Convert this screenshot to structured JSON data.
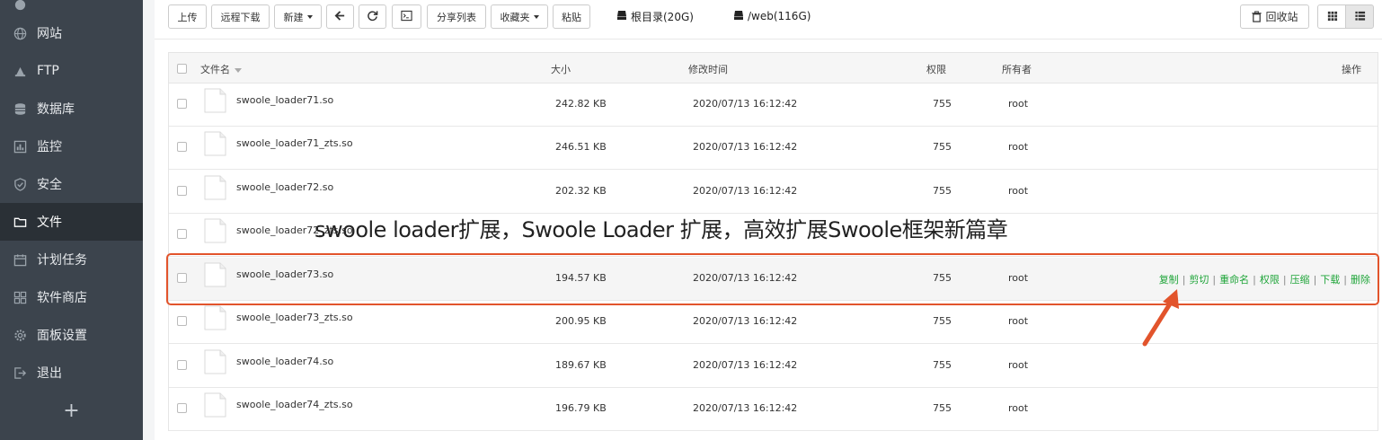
{
  "sidebar": {
    "items": [
      {
        "label": "网站",
        "icon": "globe-icon"
      },
      {
        "label": "FTP",
        "icon": "ftp-icon"
      },
      {
        "label": "数据库",
        "icon": "database-icon"
      },
      {
        "label": "监控",
        "icon": "monitor-icon"
      },
      {
        "label": "安全",
        "icon": "shield-icon"
      },
      {
        "label": "文件",
        "icon": "folder-icon",
        "active": true
      },
      {
        "label": "计划任务",
        "icon": "calendar-icon"
      },
      {
        "label": "软件商店",
        "icon": "apps-icon"
      },
      {
        "label": "面板设置",
        "icon": "gear-icon"
      },
      {
        "label": "退出",
        "icon": "logout-icon"
      }
    ],
    "add_label": "+"
  },
  "toolbar": {
    "upload": "上传",
    "remote_download": "远程下载",
    "new": "新建",
    "share_list": "分享列表",
    "favorites": "收藏夹",
    "paste": "粘贴",
    "disks": [
      {
        "label": "根目录(20G)"
      },
      {
        "label": "/web(116G)"
      }
    ],
    "recycle_bin": "回收站"
  },
  "table": {
    "headers": {
      "name": "文件名",
      "size": "大小",
      "modified": "修改时间",
      "permission": "权限",
      "owner": "所有者",
      "actions": "操作"
    },
    "rows": [
      {
        "name": "swoole_loader71.so",
        "size": "242.82 KB",
        "modified": "2020/07/13 16:12:42",
        "permission": "755",
        "owner": "root"
      },
      {
        "name": "swoole_loader71_zts.so",
        "size": "246.51 KB",
        "modified": "2020/07/13 16:12:42",
        "permission": "755",
        "owner": "root"
      },
      {
        "name": "swoole_loader72.so",
        "size": "202.32 KB",
        "modified": "2020/07/13 16:12:42",
        "permission": "755",
        "owner": "root"
      },
      {
        "name": "swoole_loader72_zts.so",
        "size": "",
        "modified": "",
        "permission": "",
        "owner": ""
      },
      {
        "name": "swoole_loader73.so",
        "size": "194.57 KB",
        "modified": "2020/07/13 16:12:42",
        "permission": "755",
        "owner": "root",
        "highlighted": true
      },
      {
        "name": "swoole_loader73_zts.so",
        "size": "200.95 KB",
        "modified": "2020/07/13 16:12:42",
        "permission": "755",
        "owner": "root"
      },
      {
        "name": "swoole_loader74.so",
        "size": "189.67 KB",
        "modified": "2020/07/13 16:12:42",
        "permission": "755",
        "owner": "root"
      },
      {
        "name": "swoole_loader74_zts.so",
        "size": "196.79 KB",
        "modified": "2020/07/13 16:12:42",
        "permission": "755",
        "owner": "root"
      }
    ],
    "row_actions": [
      "复制",
      "剪切",
      "重命名",
      "权限",
      "压缩",
      "下载",
      "删除"
    ]
  },
  "overlay": {
    "caption": "swoole loader扩展，Swoole Loader 扩展，高效扩展Swoole框架新篇章"
  },
  "colors": {
    "sidebar_bg": "#3c444d",
    "sidebar_active": "#2a3036",
    "action_green": "#20a53a",
    "highlight_red": "#e2542c"
  }
}
